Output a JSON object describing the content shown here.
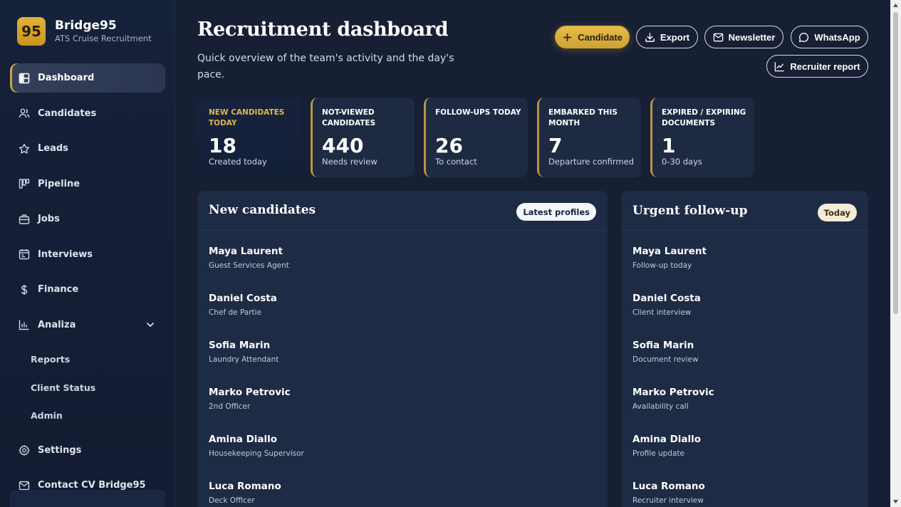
{
  "brand": {
    "logo": "95",
    "name": "Bridge95",
    "subtitle": "ATS Cruise Recruitment"
  },
  "sidebar": {
    "items": [
      {
        "label": "Dashboard",
        "icon": "dashboard-icon"
      },
      {
        "label": "Candidates",
        "icon": "users-icon"
      },
      {
        "label": "Leads",
        "icon": "star-icon"
      },
      {
        "label": "Pipeline",
        "icon": "pipeline-icon"
      },
      {
        "label": "Jobs",
        "icon": "briefcase-icon"
      },
      {
        "label": "Interviews",
        "icon": "calendar-icon"
      },
      {
        "label": "Finance",
        "icon": "dollar-icon"
      },
      {
        "label": "Analiza",
        "icon": "bar-chart-icon"
      }
    ],
    "sub_items": [
      "Reports",
      "Client Status",
      "Admin"
    ],
    "bottom_items": [
      {
        "label": "Settings",
        "icon": "gear-icon"
      },
      {
        "label": "Contact CV Bridge95",
        "icon": "mail-icon"
      }
    ]
  },
  "header": {
    "title": "Recruitment dashboard",
    "subtitle": "Quick overview of the team's activity and the day's pace.",
    "buttons": {
      "candidate": "Candidate",
      "export": "Export",
      "newsletter": "Newsletter",
      "whatsapp": "WhatsApp",
      "recruiter_report": "Recruiter report"
    }
  },
  "stats": [
    {
      "label": "New candidates today",
      "value": "18",
      "sub": "Created today"
    },
    {
      "label": "Not-viewed candidates",
      "value": "440",
      "sub": "Needs review"
    },
    {
      "label": "Follow-ups today",
      "value": "26",
      "sub": "To contact"
    },
    {
      "label": "Embarked this month",
      "value": "7",
      "sub": "Departure confirmed"
    },
    {
      "label": "Expired / expiring documents",
      "value": "1",
      "sub": "0-30 days"
    }
  ],
  "new_candidates": {
    "title": "New candidates",
    "badge": "Latest profiles",
    "rows": [
      {
        "name": "Maya Laurent",
        "role": "Guest Services Agent"
      },
      {
        "name": "Daniel Costa",
        "role": "Chef de Partie"
      },
      {
        "name": "Sofia Marin",
        "role": "Laundry Attendant"
      },
      {
        "name": "Marko Petrovic",
        "role": "2nd Officer"
      },
      {
        "name": "Amina Diallo",
        "role": "Housekeeping Supervisor"
      },
      {
        "name": "Luca Romano",
        "role": "Deck Officer"
      }
    ]
  },
  "urgent_followup": {
    "title": "Urgent follow-up",
    "badge": "Today",
    "rows": [
      {
        "name": "Maya Laurent",
        "task": "Follow-up today"
      },
      {
        "name": "Daniel Costa",
        "task": "Client interview"
      },
      {
        "name": "Sofia Marin",
        "task": "Document review"
      },
      {
        "name": "Marko Petrovic",
        "task": "Availability call"
      },
      {
        "name": "Amina Diallo",
        "task": "Profile update"
      },
      {
        "name": "Luca Romano",
        "task": "Recruiter interview"
      }
    ]
  },
  "colors": {
    "accent": "#cfa234",
    "background": "#161f33",
    "panel": "#1e2b45"
  }
}
